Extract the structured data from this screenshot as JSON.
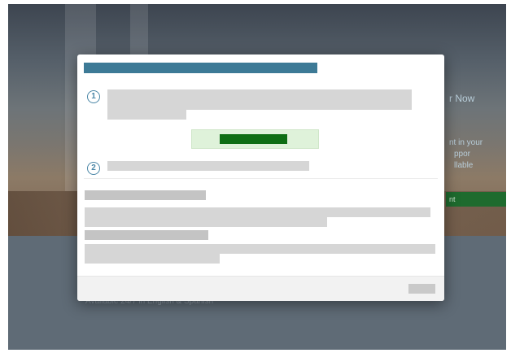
{
  "background": {
    "peek_title": "r Now",
    "peek_line1": "nt in your",
    "peek_line2": "ppor",
    "peek_line3": "llable",
    "peek_button_label": "nt",
    "under_text": "Available 24/7 in English & Spanish"
  },
  "modal": {
    "title_color": "#3d7a96",
    "steps": [
      {
        "number": "1"
      },
      {
        "number": "2"
      }
    ],
    "primary_button_color": "#0e6e14",
    "primary_button_background": "#dff2da"
  }
}
